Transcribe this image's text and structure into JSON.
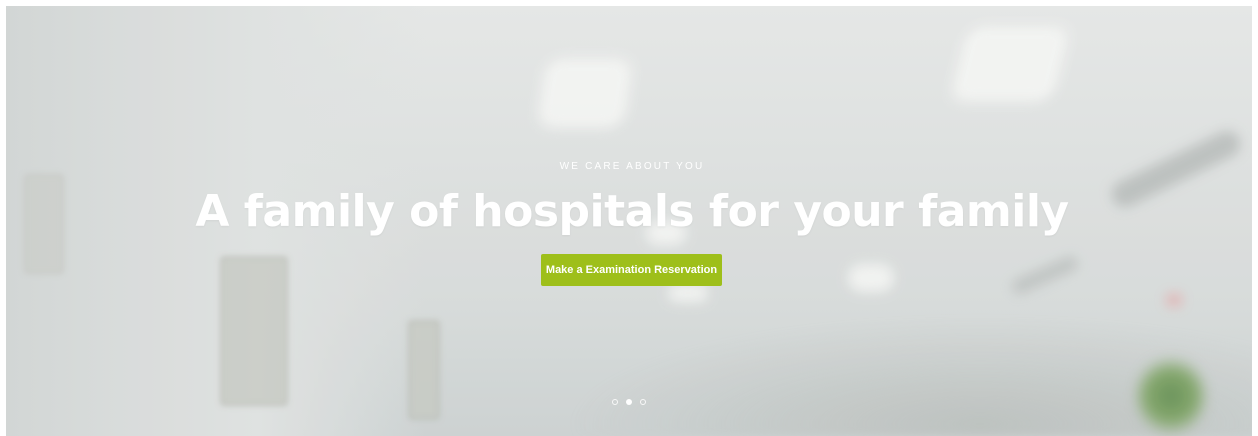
{
  "hero": {
    "kicker": "WE CARE ABOUT YOU",
    "headline": "A family of hospitals for your family",
    "cta_label": "Make a Examination Reservation",
    "accent_color": "#9ebf1a"
  },
  "slider": {
    "slide_count": 3,
    "active_index": 1
  }
}
